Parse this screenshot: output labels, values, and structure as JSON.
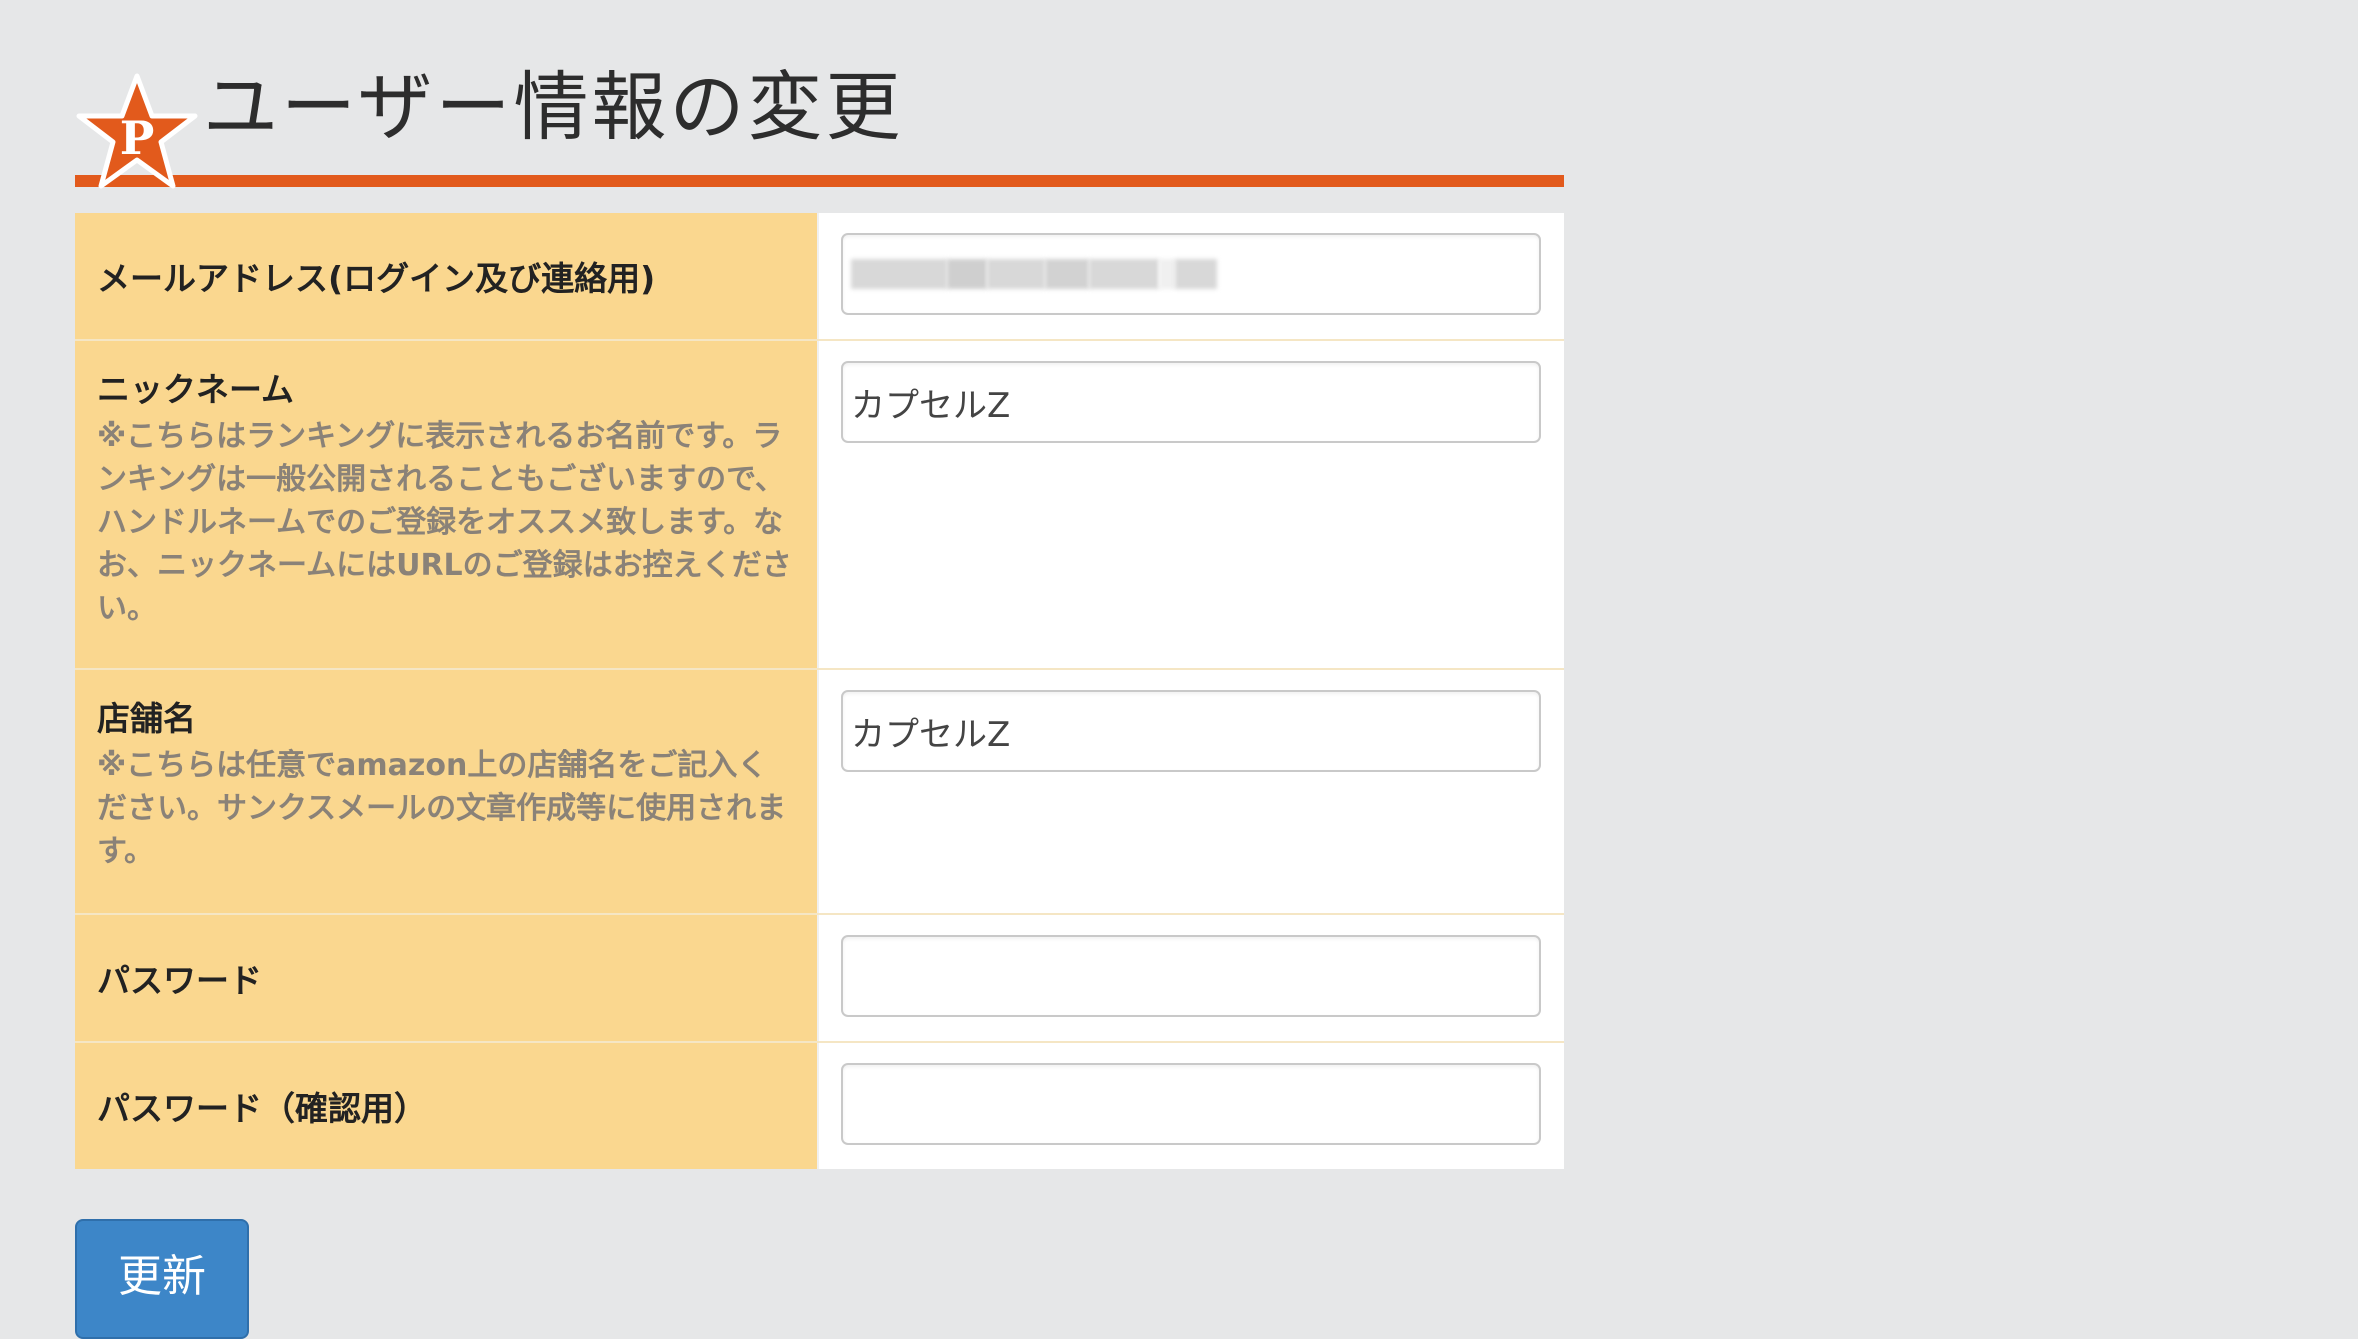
{
  "page": {
    "title": "ユーザー情報の変更",
    "accent_color": "#e25a1c",
    "label_background": "#fad78f",
    "button_color": "#3d86c8"
  },
  "logo": {
    "icon": "star-p-icon",
    "letter": "P"
  },
  "form": {
    "email": {
      "label": "メールアドレス(ログイン及び連絡用)",
      "value": ""
    },
    "nickname": {
      "label": "ニックネーム",
      "note": "※こちらはランキングに表示されるお名前です。ランキングは一般公開されることもございますので、ハンドルネームでのご登録をオススメ致します。なお、ニックネームにはURLのご登録はお控えください。",
      "value": "カプセルZ"
    },
    "store_name": {
      "label": "店舗名",
      "note": "※こちらは任意でamazon上の店舗名をご記入ください。サンクスメールの文章作成等に使用されます。",
      "value": "カプセルZ"
    },
    "password": {
      "label": "パスワード",
      "value": ""
    },
    "password_confirm": {
      "label": "パスワード（確認用）",
      "value": ""
    }
  },
  "actions": {
    "update_label": "更新"
  }
}
